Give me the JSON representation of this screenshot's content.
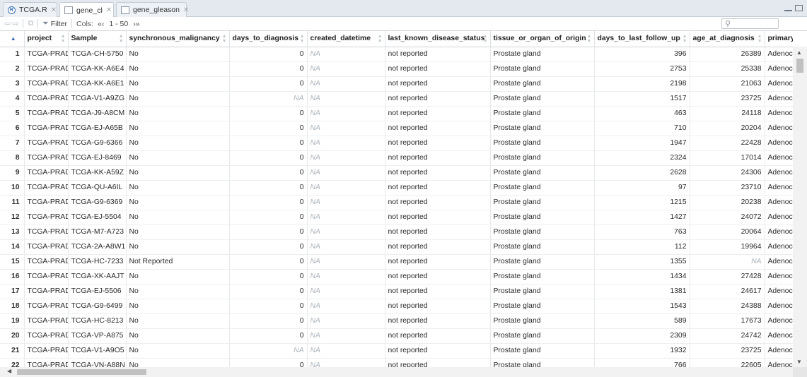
{
  "tabs": [
    {
      "label": "TCGA.R",
      "icon": "r-file-icon",
      "active": false
    },
    {
      "label": "gene_cl",
      "icon": "data-grid-icon",
      "active": true
    },
    {
      "label": "gene_gleason",
      "icon": "data-grid-icon",
      "active": false
    }
  ],
  "toolbar": {
    "filter_label": "Filter",
    "cols_label": "Cols:",
    "prev_cols": "«‹",
    "col_range": "1 - 50",
    "next_cols": "›»"
  },
  "columns": [
    "project",
    "Sample",
    "synchronous_malignancy",
    "days_to_diagnosis",
    "created_datetime",
    "last_known_disease_status",
    "tissue_or_organ_of_origin",
    "days_to_last_follow_up",
    "age_at_diagnosis",
    "primary_dia"
  ],
  "rows": [
    [
      "1",
      "TCGA-PRAD",
      "TCGA-CH-5750",
      "No",
      "0",
      "NA",
      "not reported",
      "Prostate gland",
      "396",
      "26389",
      "Adenoc"
    ],
    [
      "2",
      "TCGA-PRAD",
      "TCGA-KK-A6E4",
      "No",
      "0",
      "NA",
      "not reported",
      "Prostate gland",
      "2753",
      "25338",
      "Adenoc"
    ],
    [
      "3",
      "TCGA-PRAD",
      "TCGA-KK-A6E1",
      "No",
      "0",
      "NA",
      "not reported",
      "Prostate gland",
      "2198",
      "21063",
      "Adenoc"
    ],
    [
      "4",
      "TCGA-PRAD",
      "TCGA-V1-A9ZG",
      "No",
      "NA",
      "NA",
      "not reported",
      "Prostate gland",
      "1517",
      "23725",
      "Adenoc"
    ],
    [
      "5",
      "TCGA-PRAD",
      "TCGA-J9-A8CM",
      "No",
      "0",
      "NA",
      "not reported",
      "Prostate gland",
      "463",
      "24118",
      "Adenoc"
    ],
    [
      "6",
      "TCGA-PRAD",
      "TCGA-EJ-A65B",
      "No",
      "0",
      "NA",
      "not reported",
      "Prostate gland",
      "710",
      "20204",
      "Adenoc"
    ],
    [
      "7",
      "TCGA-PRAD",
      "TCGA-G9-6366",
      "No",
      "0",
      "NA",
      "not reported",
      "Prostate gland",
      "1947",
      "22428",
      "Adenoc"
    ],
    [
      "8",
      "TCGA-PRAD",
      "TCGA-EJ-8469",
      "No",
      "0",
      "NA",
      "not reported",
      "Prostate gland",
      "2324",
      "17014",
      "Adenoc"
    ],
    [
      "9",
      "TCGA-PRAD",
      "TCGA-KK-A59Z",
      "No",
      "0",
      "NA",
      "not reported",
      "Prostate gland",
      "2628",
      "24306",
      "Adenoc"
    ],
    [
      "10",
      "TCGA-PRAD",
      "TCGA-QU-A6IL",
      "No",
      "0",
      "NA",
      "not reported",
      "Prostate gland",
      "97",
      "23710",
      "Adenoc"
    ],
    [
      "11",
      "TCGA-PRAD",
      "TCGA-G9-6369",
      "No",
      "0",
      "NA",
      "not reported",
      "Prostate gland",
      "1215",
      "20238",
      "Adenoc"
    ],
    [
      "12",
      "TCGA-PRAD",
      "TCGA-EJ-5504",
      "No",
      "0",
      "NA",
      "not reported",
      "Prostate gland",
      "1427",
      "24072",
      "Adenoc"
    ],
    [
      "13",
      "TCGA-PRAD",
      "TCGA-M7-A723",
      "No",
      "0",
      "NA",
      "not reported",
      "Prostate gland",
      "763",
      "20064",
      "Adenoc"
    ],
    [
      "14",
      "TCGA-PRAD",
      "TCGA-2A-A8W1",
      "No",
      "0",
      "NA",
      "not reported",
      "Prostate gland",
      "112",
      "19964",
      "Adenoc"
    ],
    [
      "15",
      "TCGA-PRAD",
      "TCGA-HC-7233",
      "Not Reported",
      "0",
      "NA",
      "not reported",
      "Prostate gland",
      "1355",
      "NA",
      "Adenoc"
    ],
    [
      "16",
      "TCGA-PRAD",
      "TCGA-XK-AAJT",
      "No",
      "0",
      "NA",
      "not reported",
      "Prostate gland",
      "1434",
      "27428",
      "Adenoc"
    ],
    [
      "17",
      "TCGA-PRAD",
      "TCGA-EJ-5506",
      "No",
      "0",
      "NA",
      "not reported",
      "Prostate gland",
      "1381",
      "24617",
      "Adenoc"
    ],
    [
      "18",
      "TCGA-PRAD",
      "TCGA-G9-6499",
      "No",
      "0",
      "NA",
      "not reported",
      "Prostate gland",
      "1543",
      "24388",
      "Adenoc"
    ],
    [
      "19",
      "TCGA-PRAD",
      "TCGA-HC-8213",
      "No",
      "0",
      "NA",
      "not reported",
      "Prostate gland",
      "589",
      "17673",
      "Adenoc"
    ],
    [
      "20",
      "TCGA-PRAD",
      "TCGA-VP-A875",
      "No",
      "0",
      "NA",
      "not reported",
      "Prostate gland",
      "2309",
      "24742",
      "Adenoc"
    ],
    [
      "21",
      "TCGA-PRAD",
      "TCGA-V1-A9O5",
      "No",
      "NA",
      "NA",
      "not reported",
      "Prostate gland",
      "1932",
      "23725",
      "Adenoc"
    ],
    [
      "22",
      "TCGA-PRAD",
      "TCGA-VN-A88N",
      "No",
      "0",
      "NA",
      "not reported",
      "Prostate gland",
      "766",
      "22605",
      "Adenoc"
    ]
  ]
}
